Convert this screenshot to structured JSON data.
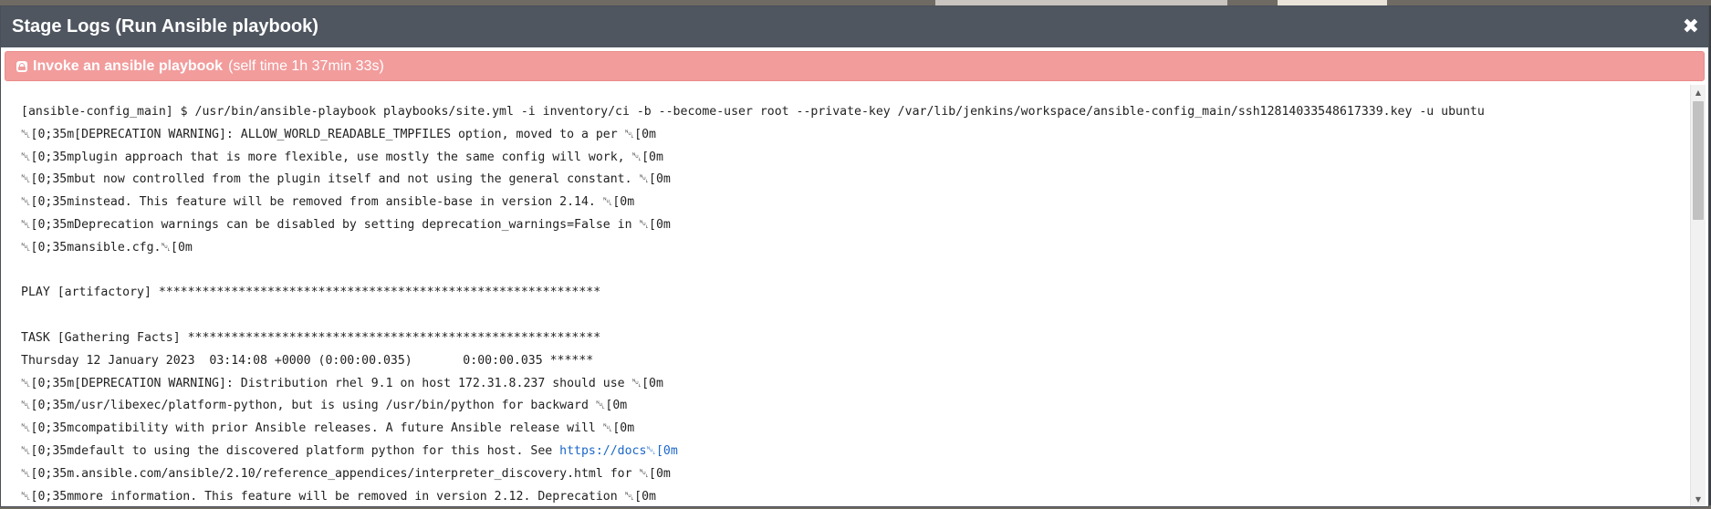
{
  "dialog": {
    "title": "Stage Logs (Run Ansible playbook)",
    "close_glyph": "✖"
  },
  "step": {
    "name": "Invoke an ansible playbook",
    "self_time": "(self time 1h 37min 33s)",
    "icon": "terminal-icon",
    "status_color": "#f29c9c"
  },
  "log": {
    "lines": [
      {
        "text": "[ansible-config_main] $ /usr/bin/ansible-playbook playbooks/site.yml -i inventory/ci -b --become-user root --private-key /var/lib/jenkins/workspace/ansible-config_main/ssh12814033548617339.key -u ubuntu"
      },
      {
        "text": "\u001b[0;35m[DEPRECATION WARNING]: ALLOW_WORLD_READABLE_TMPFILES option, moved to a per \u001b[0m"
      },
      {
        "text": "\u001b[0;35mplugin approach that is more flexible, use mostly the same config will work, \u001b[0m"
      },
      {
        "text": "\u001b[0;35mbut now controlled from the plugin itself and not using the general constant. \u001b[0m"
      },
      {
        "text": "\u001b[0;35minstead. This feature will be removed from ansible-base in version 2.14. \u001b[0m"
      },
      {
        "text": "\u001b[0;35mDeprecation warnings can be disabled by setting deprecation_warnings=False in \u001b[0m"
      },
      {
        "text": "\u001b[0;35mansible.cfg.\u001b[0m"
      },
      {
        "text": ""
      },
      {
        "text": "PLAY [artifactory] *************************************************************"
      },
      {
        "text": ""
      },
      {
        "text": "TASK [Gathering Facts] *********************************************************"
      },
      {
        "text": "Thursday 12 January 2023  03:14:08 +0000 (0:00:00.035)       0:00:00.035 ******"
      },
      {
        "text": "\u001b[0;35m[DEPRECATION WARNING]: Distribution rhel 9.1 on host 172.31.8.237 should use \u001b[0m"
      },
      {
        "text": "\u001b[0;35m/usr/libexec/platform-python, but is using /usr/bin/python for backward \u001b[0m"
      },
      {
        "text": "\u001b[0;35mcompatibility with prior Ansible releases. A future Ansible release will \u001b[0m"
      },
      {
        "text": "\u001b[0;35mdefault to using the discovered platform python for this host. See ",
        "link": "https://docs\u001b[0m"
      },
      {
        "text": "\u001b[0;35m.ansible.com/ansible/2.10/reference_appendices/interpreter_discovery.html for \u001b[0m"
      },
      {
        "text": "\u001b[0;35mmore information. This feature will be removed in version 2.12. Deprecation \u001b[0m"
      }
    ]
  },
  "scrollbar": {
    "up_glyph": "▲",
    "down_glyph": "▼"
  },
  "colors": {
    "header_bg": "#4f5660",
    "step_bar_bg": "#f29c9c",
    "link": "#1a66c9",
    "log_text": "#222222"
  }
}
